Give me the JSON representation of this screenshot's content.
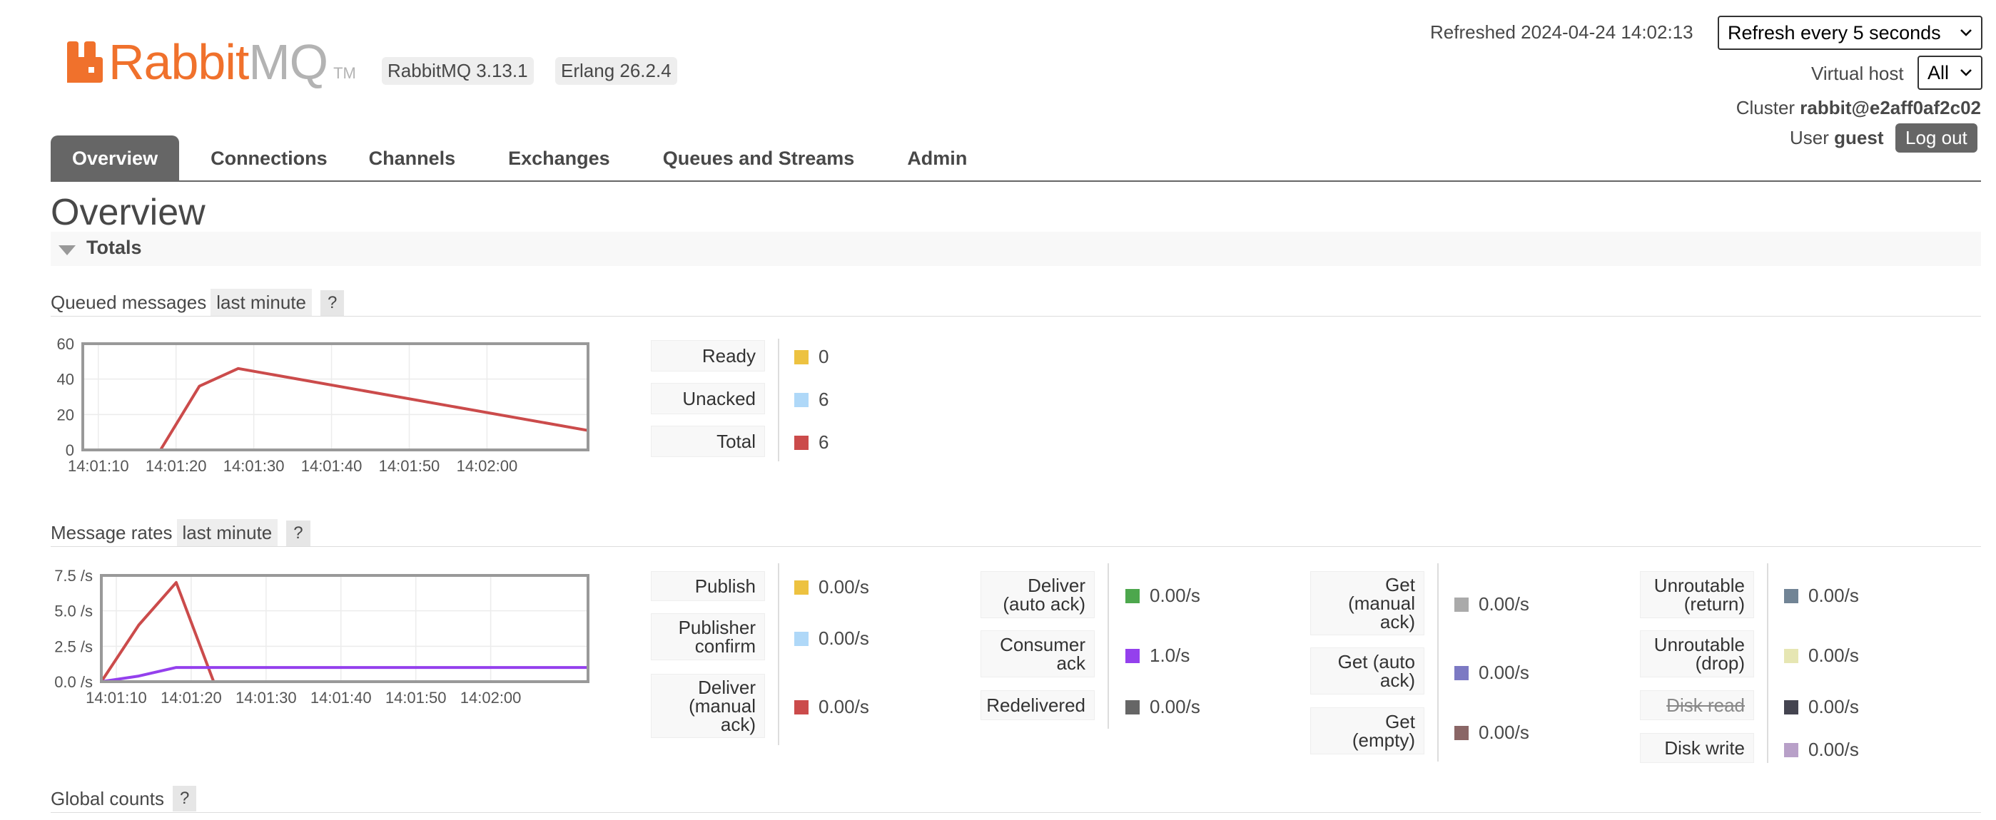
{
  "header": {
    "logo_rabbit": "Rabbit",
    "logo_mq": "MQ",
    "logo_tm": "TM",
    "version": "RabbitMQ 3.13.1",
    "erlang": "Erlang 26.2.4",
    "refreshed_label": "Refreshed 2024-04-24 14:02:13",
    "refresh_select": "Refresh every 5 seconds",
    "virtual_host_label": "Virtual host",
    "virtual_host_value": "All",
    "cluster_label": "Cluster",
    "cluster_value": "rabbit@e2aff0af2c02",
    "user_label": "User",
    "user_value": "guest",
    "logout": "Log out"
  },
  "tabs": [
    {
      "label": "Overview",
      "active": true
    },
    {
      "label": "Connections"
    },
    {
      "label": "Channels"
    },
    {
      "label": "Exchanges"
    },
    {
      "label": "Queues and Streams"
    },
    {
      "label": "Admin"
    }
  ],
  "page_title": "Overview",
  "totals_label": "Totals",
  "queued": {
    "title": "Queued messages",
    "range": "last minute",
    "help": "?",
    "legend": [
      {
        "label": "Ready",
        "value": "0",
        "color": "#edc240"
      },
      {
        "label": "Unacked",
        "value": "6",
        "color": "#afd8f8"
      },
      {
        "label": "Total",
        "value": "6",
        "color": "#cb4b4b"
      }
    ]
  },
  "rates": {
    "title": "Message rates",
    "range": "last minute",
    "help": "?",
    "columns": [
      [
        {
          "label": "Publish",
          "value": "0.00/s",
          "color": "#edc240"
        },
        {
          "label": "Publisher confirm",
          "value": "0.00/s",
          "color": "#afd8f8"
        },
        {
          "label": "Deliver (manual ack)",
          "value": "0.00/s",
          "color": "#cb4b4b"
        }
      ],
      [
        {
          "label": "Deliver (auto ack)",
          "value": "0.00/s",
          "color": "#4da74d"
        },
        {
          "label": "Consumer ack",
          "value": "1.0/s",
          "color": "#9440ed"
        },
        {
          "label": "Redelivered",
          "value": "0.00/s",
          "color": "#666666"
        }
      ],
      [
        {
          "label": "Get (manual ack)",
          "value": "0.00/s",
          "color": "#aaaaaa"
        },
        {
          "label": "Get (auto ack)",
          "value": "0.00/s",
          "color": "#7c79c3"
        },
        {
          "label": "Get (empty)",
          "value": "0.00/s",
          "color": "#8a6666"
        }
      ],
      [
        {
          "label": "Unroutable (return)",
          "value": "0.00/s",
          "color": "#718495"
        },
        {
          "label": "Unroutable (drop)",
          "value": "0.00/s",
          "color": "#e6e6b3"
        },
        {
          "label": "Disk read",
          "value": "0.00/s",
          "color": "#444450"
        },
        {
          "label": "Disk write",
          "value": "0.00/s",
          "color": "#b8a0c8"
        }
      ]
    ]
  },
  "global_counts": {
    "title": "Global counts",
    "help": "?"
  },
  "chart_data": [
    {
      "type": "line",
      "title": "Queued messages",
      "x": [
        "14:01:08",
        "14:01:13",
        "14:01:18",
        "14:01:23",
        "14:01:28",
        "14:02:13"
      ],
      "xticks": [
        "14:01:10",
        "14:01:20",
        "14:01:30",
        "14:01:40",
        "14:01:50",
        "14:02:00"
      ],
      "ylim": [
        0,
        60
      ],
      "yticks": [
        "0",
        "20",
        "40",
        "60"
      ],
      "grid": true,
      "series": [
        {
          "name": "Ready",
          "color": "#edc240",
          "values": [
            0,
            0,
            0,
            0,
            0,
            0
          ]
        },
        {
          "name": "Unacked",
          "color": "#afd8f8",
          "values": [
            0,
            0,
            0,
            0,
            0,
            0
          ]
        },
        {
          "name": "Total",
          "color": "#cb4b4b",
          "values": [
            0,
            0,
            0,
            36,
            46,
            11
          ]
        }
      ]
    },
    {
      "type": "line",
      "title": "Message rates",
      "x": [
        "14:01:08",
        "14:01:13",
        "14:01:18",
        "14:01:23",
        "14:01:28",
        "14:02:13"
      ],
      "xticks": [
        "14:01:10",
        "14:01:20",
        "14:01:30",
        "14:01:40",
        "14:01:50",
        "14:02:00"
      ],
      "ylim": [
        0,
        7.5
      ],
      "yticks": [
        "0.0 /s",
        "2.5 /s",
        "5.0 /s",
        "7.5 /s"
      ],
      "grid": true,
      "series": [
        {
          "name": "Deliver (manual ack)",
          "color": "#cb4b4b",
          "values": [
            0,
            4,
            7,
            0,
            0,
            0
          ]
        },
        {
          "name": "Consumer ack",
          "color": "#9440ed",
          "values": [
            0,
            0.4,
            1.0,
            1.0,
            1.0,
            1.0
          ]
        }
      ]
    }
  ]
}
